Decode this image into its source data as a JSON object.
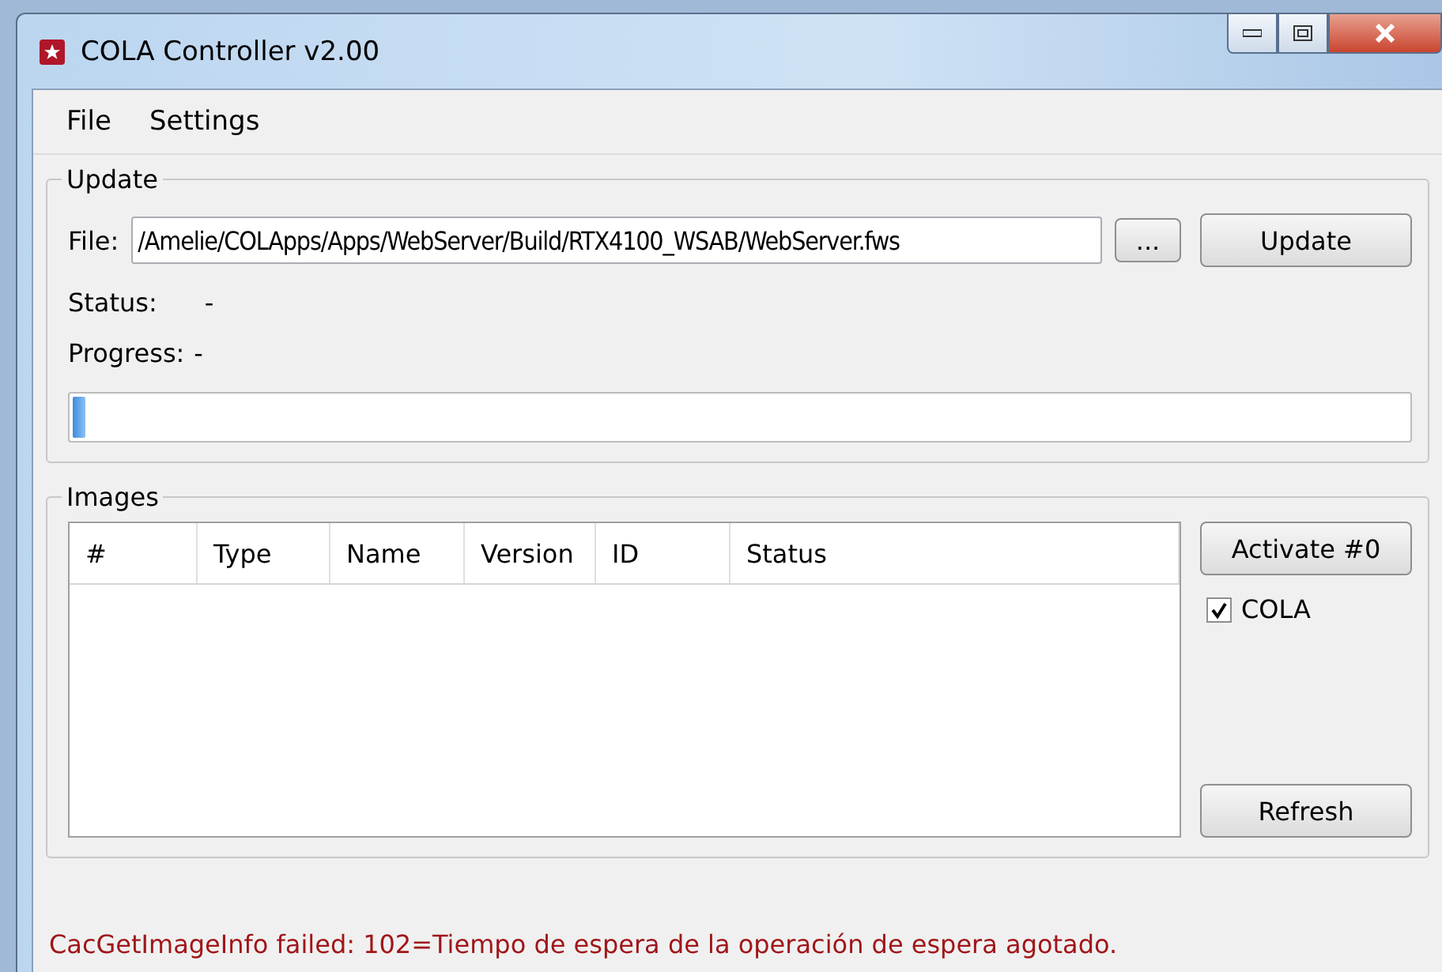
{
  "window": {
    "title": "COLA Controller v2.00"
  },
  "menu": [
    "File",
    "Settings"
  ],
  "update": {
    "title": "Update",
    "file_label": "File:",
    "file_value": "/Amelie/COLApps/Apps/WebServer/Build/RTX4100_WSAB/WebServer.fws",
    "browse": "...",
    "button": "Update",
    "status_label": "Status:",
    "status_value": "-",
    "progress_label": "Progress:",
    "progress_value": "-",
    "level": 0.01
  },
  "images": {
    "title": "Images",
    "columns": [
      "#",
      "Type",
      "Name",
      "Version",
      "ID",
      "Status"
    ],
    "activate": "Activate #0",
    "cola": {
      "label": "COLA",
      "checked": true
    },
    "refresh": "Refresh"
  },
  "status_bar": "CacGetImageInfo failed: 102=Tiempo de espera de la operación de espera agotado."
}
